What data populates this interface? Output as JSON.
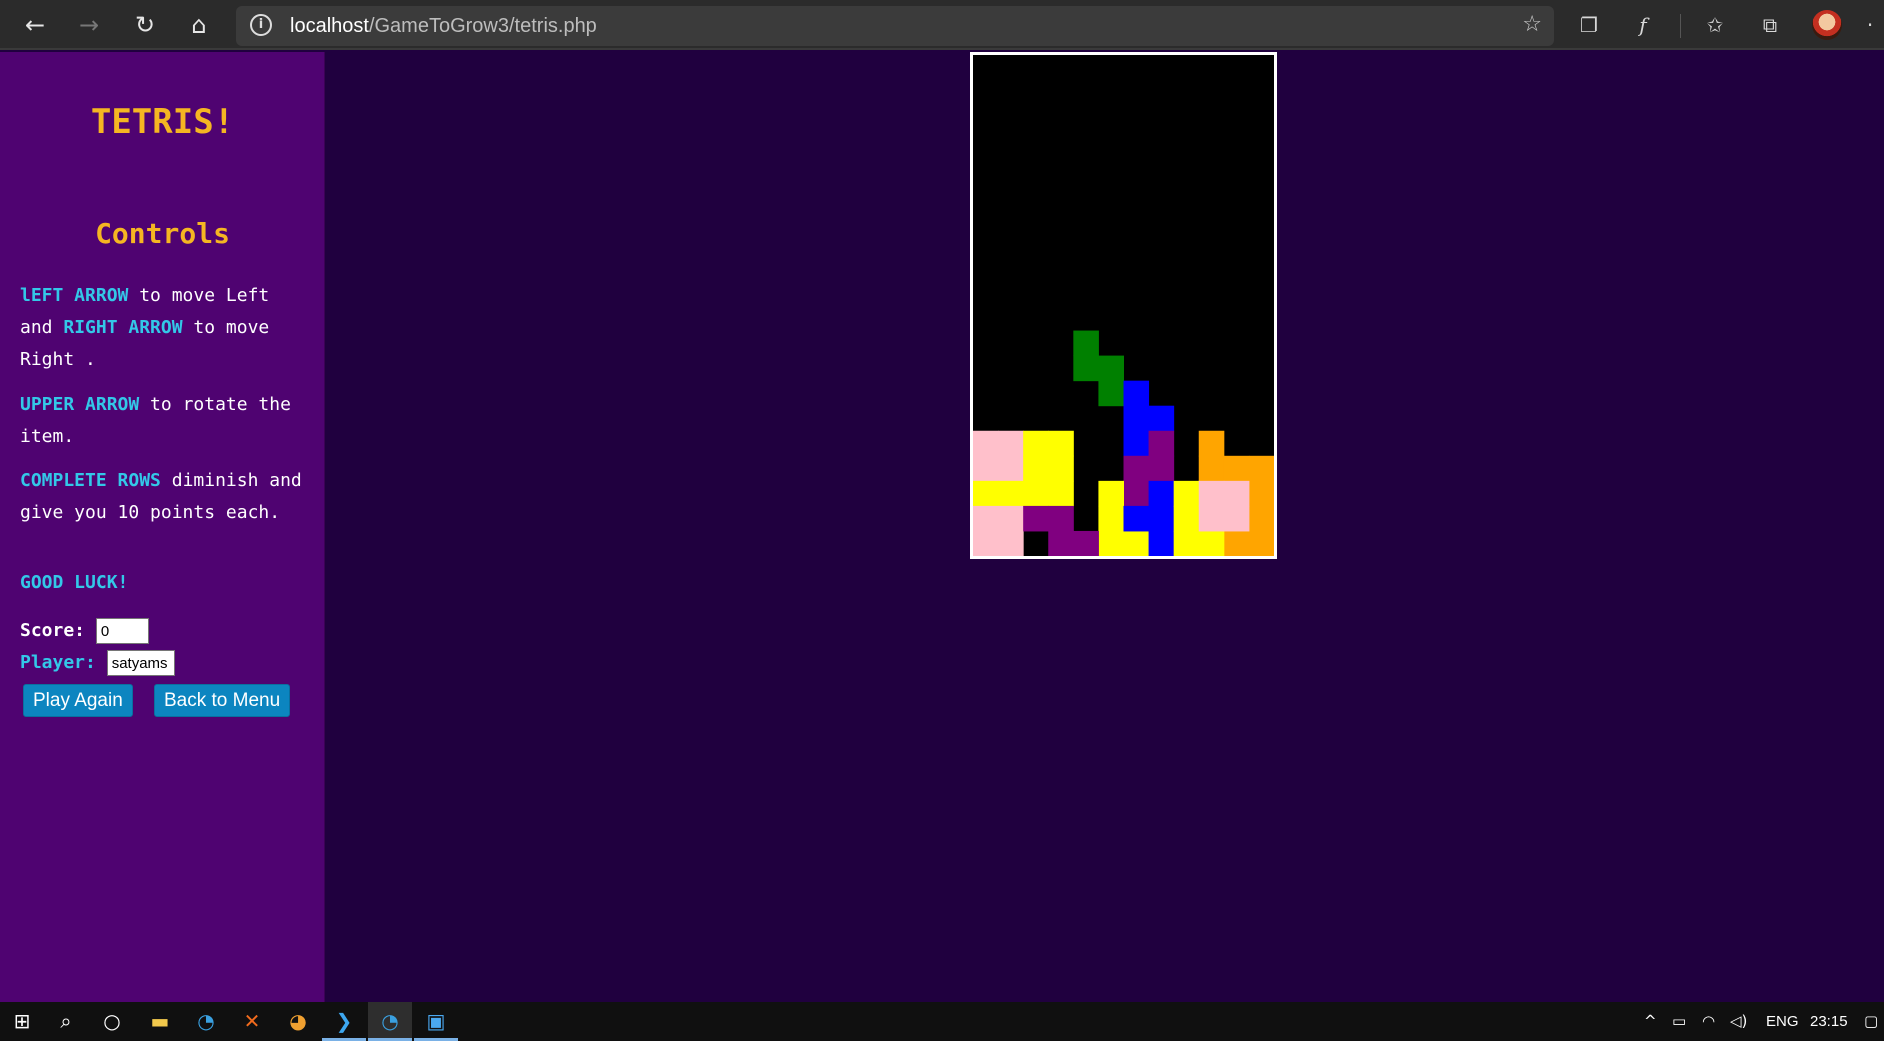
{
  "browser": {
    "url_host": "localhost",
    "url_path": "/GameToGrow3/tetris.php"
  },
  "sidebar": {
    "title": "TETRIS!",
    "controls_heading": "Controls",
    "instructions": [
      {
        "key": "lEFT ARROW",
        "text1": " to move Left and ",
        "key2": "RIGHT ARROW",
        "text2": " to move Right ."
      },
      {
        "key": "UPPER ARROW",
        "text1": " to rotate the item."
      },
      {
        "key": "COMPLETE ROWS",
        "text1": " diminish and give you 10 points each."
      }
    ],
    "good_luck": "GOOD LUCK!",
    "score_label": "Score:",
    "score_value": "0",
    "player_label": "Player:",
    "player_value": "satyams",
    "play_again_label": "Play Again",
    "back_to_menu_label": "Back to Menu"
  },
  "board": {
    "cols": 12,
    "rows": 20,
    "colors": {
      "pink": "#ffc0cb",
      "yellow": "#ffff00",
      "green": "#008000",
      "blue": "#0000ff",
      "purple": "#800080",
      "orange": "#ffa500",
      "empty": "#000000",
      "border": "#ffffff"
    },
    "cells": [
      {
        "r": 11,
        "c": 4,
        "color": "green"
      },
      {
        "r": 12,
        "c": 4,
        "color": "green"
      },
      {
        "r": 12,
        "c": 5,
        "color": "green"
      },
      {
        "r": 13,
        "c": 5,
        "color": "green"
      },
      {
        "r": 13,
        "c": 6,
        "color": "blue"
      },
      {
        "r": 14,
        "c": 6,
        "color": "blue"
      },
      {
        "r": 14,
        "c": 7,
        "color": "blue"
      },
      {
        "r": 15,
        "c": 6,
        "color": "blue"
      },
      {
        "r": 15,
        "c": 0,
        "color": "pink"
      },
      {
        "r": 15,
        "c": 1,
        "color": "pink"
      },
      {
        "r": 16,
        "c": 0,
        "color": "pink"
      },
      {
        "r": 16,
        "c": 1,
        "color": "pink"
      },
      {
        "r": 15,
        "c": 2,
        "color": "yellow"
      },
      {
        "r": 15,
        "c": 3,
        "color": "yellow"
      },
      {
        "r": 16,
        "c": 2,
        "color": "yellow"
      },
      {
        "r": 16,
        "c": 3,
        "color": "yellow"
      },
      {
        "r": 15,
        "c": 7,
        "color": "purple"
      },
      {
        "r": 16,
        "c": 6,
        "color": "purple"
      },
      {
        "r": 16,
        "c": 7,
        "color": "purple"
      },
      {
        "r": 17,
        "c": 6,
        "color": "purple"
      },
      {
        "r": 15,
        "c": 9,
        "color": "orange"
      },
      {
        "r": 16,
        "c": 9,
        "color": "orange"
      },
      {
        "r": 16,
        "c": 10,
        "color": "orange"
      },
      {
        "r": 16,
        "c": 11,
        "color": "orange"
      },
      {
        "r": 17,
        "c": 11,
        "color": "orange"
      },
      {
        "r": 18,
        "c": 11,
        "color": "orange"
      },
      {
        "r": 19,
        "c": 10,
        "color": "orange"
      },
      {
        "r": 19,
        "c": 11,
        "color": "orange"
      },
      {
        "r": 17,
        "c": 0,
        "color": "yellow"
      },
      {
        "r": 17,
        "c": 1,
        "color": "yellow"
      },
      {
        "r": 17,
        "c": 2,
        "color": "yellow"
      },
      {
        "r": 17,
        "c": 3,
        "color": "yellow"
      },
      {
        "r": 17,
        "c": 5,
        "color": "yellow"
      },
      {
        "r": 18,
        "c": 5,
        "color": "yellow"
      },
      {
        "r": 19,
        "c": 5,
        "color": "yellow"
      },
      {
        "r": 19,
        "c": 6,
        "color": "yellow"
      },
      {
        "r": 17,
        "c": 7,
        "color": "blue"
      },
      {
        "r": 18,
        "c": 6,
        "color": "blue"
      },
      {
        "r": 18,
        "c": 7,
        "color": "blue"
      },
      {
        "r": 19,
        "c": 7,
        "color": "blue"
      },
      {
        "r": 17,
        "c": 8,
        "color": "yellow"
      },
      {
        "r": 18,
        "c": 8,
        "color": "yellow"
      },
      {
        "r": 19,
        "c": 8,
        "color": "yellow"
      },
      {
        "r": 19,
        "c": 9,
        "color": "yellow"
      },
      {
        "r": 17,
        "c": 9,
        "color": "pink"
      },
      {
        "r": 17,
        "c": 10,
        "color": "pink"
      },
      {
        "r": 18,
        "c": 9,
        "color": "pink"
      },
      {
        "r": 18,
        "c": 10,
        "color": "pink"
      },
      {
        "r": 18,
        "c": 0,
        "color": "pink"
      },
      {
        "r": 18,
        "c": 1,
        "color": "pink"
      },
      {
        "r": 19,
        "c": 0,
        "color": "pink"
      },
      {
        "r": 19,
        "c": 1,
        "color": "pink"
      },
      {
        "r": 18,
        "c": 2,
        "color": "purple"
      },
      {
        "r": 18,
        "c": 3,
        "color": "purple"
      },
      {
        "r": 19,
        "c": 3,
        "color": "purple"
      },
      {
        "r": 19,
        "c": 4,
        "color": "purple"
      }
    ]
  },
  "taskbar": {
    "language": "ENG",
    "time": "23:15"
  },
  "icons": {
    "back": "back-arrow-icon",
    "forward": "forward-arrow-icon",
    "refresh": "refresh-icon",
    "home": "home-icon",
    "info": "info-icon",
    "favorite": "star-icon"
  }
}
